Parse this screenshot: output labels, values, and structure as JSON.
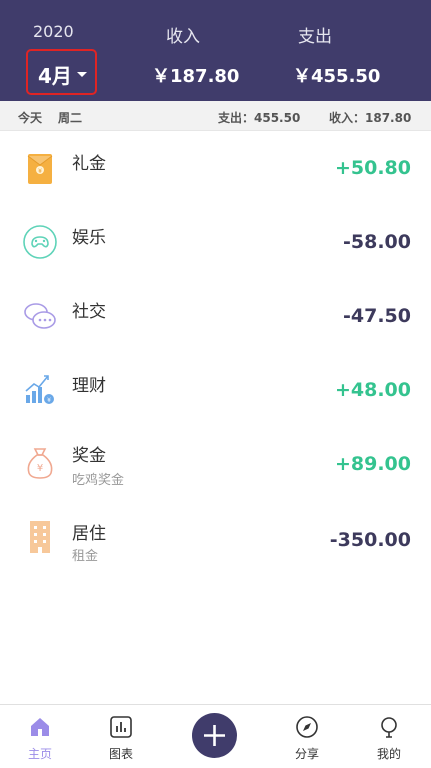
{
  "header": {
    "year": "2020",
    "month": "4月",
    "income_label": "收入",
    "expense_label": "支出",
    "income_total": "￥187.80",
    "expense_total": "￥455.50"
  },
  "summary": {
    "today": "今天",
    "weekday": "周二",
    "expense": "支出：455.50",
    "income": "收入：187.80"
  },
  "items": [
    {
      "name": "礼金",
      "sub": "",
      "amount": "+50.80",
      "icon": "red-envelope-icon",
      "color": "#f5b041"
    },
    {
      "name": "娱乐",
      "sub": "",
      "amount": "-58.00",
      "icon": "gamepad-icon",
      "color": "#5ed3b8"
    },
    {
      "name": "社交",
      "sub": "",
      "amount": "-47.50",
      "icon": "chat-icon",
      "color": "#a99be6"
    },
    {
      "name": "理财",
      "sub": "",
      "amount": "+48.00",
      "icon": "finance-chart-icon",
      "color": "#6aa8e8"
    },
    {
      "name": "奖金",
      "sub": "吃鸡奖金",
      "amount": "+89.00",
      "icon": "money-bag-icon",
      "color": "#f0a890"
    },
    {
      "name": "居住",
      "sub": "租金",
      "amount": "-350.00",
      "icon": "building-icon",
      "color": "#f7c89a"
    }
  ],
  "tabs": {
    "home": "主页",
    "chart": "图表",
    "share": "分享",
    "mine": "我的"
  },
  "colors": {
    "header_bg": "#403c6b",
    "positive": "#34c38f",
    "negative": "#3d3a5c",
    "active_tab": "#9b8ce8"
  }
}
